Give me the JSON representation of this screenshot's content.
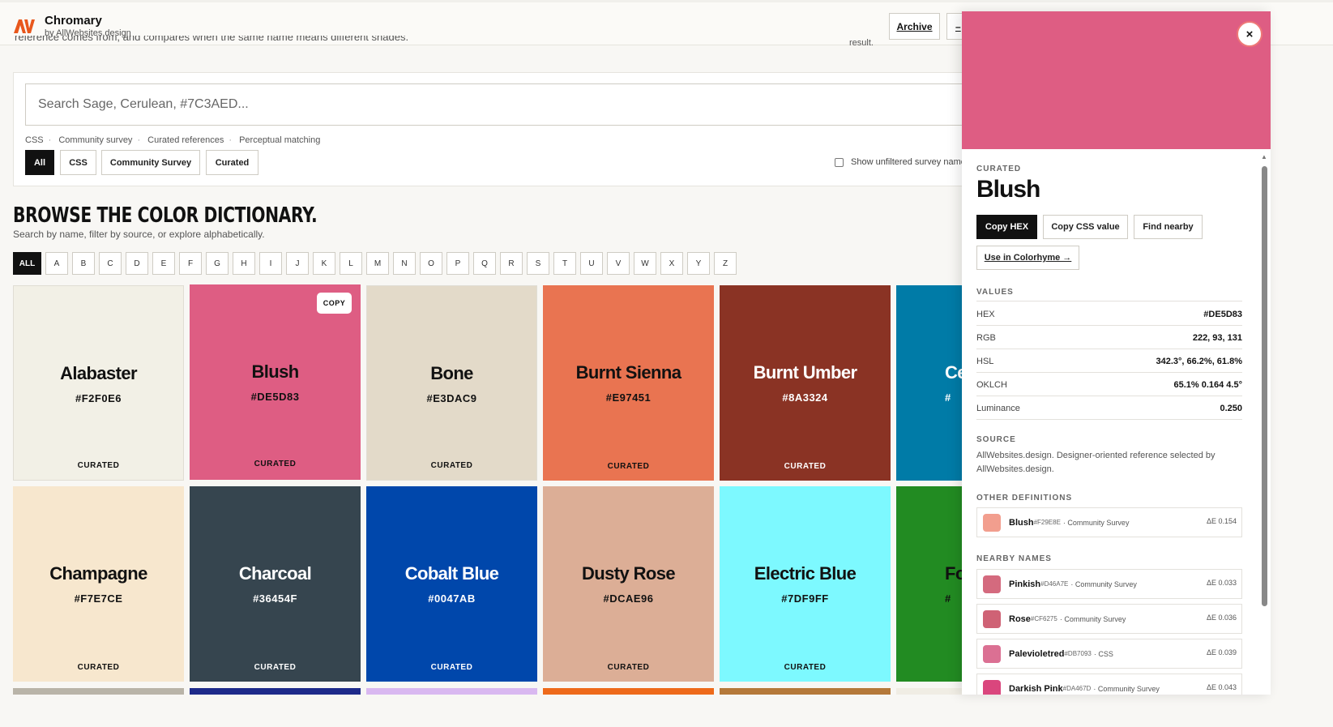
{
  "header": {
    "brand_name": "Chromary",
    "brand_sub": "by AllWebsites.design",
    "archive_label": "Archive",
    "cut_intro": "reference comes from, and compares when the same name means different shades.",
    "cut_right": "result."
  },
  "search": {
    "placeholder": "Search Sage, Cerulean, #7C3AED...",
    "hints": [
      "CSS",
      "Community survey",
      "Curated references",
      "Perceptual matching"
    ],
    "filters": [
      "All",
      "CSS",
      "Community Survey",
      "Curated"
    ],
    "active_filter": "All",
    "unfiltered_label": "Show unfiltered survey names"
  },
  "browse": {
    "title": "BROWSE THE COLOR DICTIONARY.",
    "subtitle": "Search by name, filter by source, or explore alphabetically.",
    "letters": [
      "ALL",
      "A",
      "B",
      "C",
      "D",
      "E",
      "F",
      "G",
      "H",
      "I",
      "J",
      "K",
      "L",
      "M",
      "N",
      "O",
      "P",
      "Q",
      "R",
      "S",
      "T",
      "U",
      "V",
      "W",
      "X",
      "Y",
      "Z"
    ]
  },
  "tiles": [
    {
      "name": "Alabaster",
      "hex": "#F2F0E6",
      "source": "CURATED",
      "bg": "#F2F0E6",
      "fg": "#111111"
    },
    {
      "name": "Blush",
      "hex": "#DE5D83",
      "source": "CURATED",
      "bg": "#DE5D83",
      "fg": "#111111",
      "copy": "COPY"
    },
    {
      "name": "Bone",
      "hex": "#E3DAC9",
      "source": "CURATED",
      "bg": "#E3DAC9",
      "fg": "#111111"
    },
    {
      "name": "Burnt Sienna",
      "hex": "#E97451",
      "source": "CURATED",
      "bg": "#E97451",
      "fg": "#111111"
    },
    {
      "name": "Burnt Umber",
      "hex": "#8A3324",
      "source": "CURATED",
      "bg": "#8A3324",
      "fg": "#FFFFFF"
    },
    {
      "name": "Ce",
      "hex": "#",
      "source": "",
      "bg": "#007BA7",
      "fg": "#FFFFFF"
    },
    {
      "name": "Champagne",
      "hex": "#F7E7CE",
      "source": "CURATED",
      "bg": "#F7E7CE",
      "fg": "#111111"
    },
    {
      "name": "Charcoal",
      "hex": "#36454F",
      "source": "CURATED",
      "bg": "#36454F",
      "fg": "#FFFFFF"
    },
    {
      "name": "Cobalt Blue",
      "hex": "#0047AB",
      "source": "CURATED",
      "bg": "#0047AB",
      "fg": "#FFFFFF"
    },
    {
      "name": "Dusty Rose",
      "hex": "#DCAE96",
      "source": "CURATED",
      "bg": "#DCAE96",
      "fg": "#111111"
    },
    {
      "name": "Electric Blue",
      "hex": "#7DF9FF",
      "source": "CURATED",
      "bg": "#7DF9FF",
      "fg": "#111111"
    },
    {
      "name": "Fore",
      "hex": "#",
      "source": "",
      "bg": "#228B22",
      "fg": "#111111"
    }
  ],
  "strip_colors": [
    "#b9b4a8",
    "#1e2a8a",
    "#d9b8f0",
    "#ee6a1a",
    "#b5793a",
    "#f0ede4"
  ],
  "panel": {
    "swatch_color": "#DE5D83",
    "close": "×",
    "source_badge": "CURATED",
    "name": "Blush",
    "copy_hex": "Copy HEX",
    "copy_css": "Copy CSS value",
    "find_nearby": "Find nearby",
    "use_colorhyme": "Use in Colorhyme →",
    "values_label": "VALUES",
    "values": [
      {
        "k": "HEX",
        "v": "#DE5D83"
      },
      {
        "k": "RGB",
        "v": "222, 93, 131"
      },
      {
        "k": "HSL",
        "v": "342.3°, 66.2%, 61.8%"
      },
      {
        "k": "OKLCH",
        "v": "65.1% 0.164 4.5°"
      },
      {
        "k": "Luminance",
        "v": "0.250"
      }
    ],
    "source_label": "SOURCE",
    "source_text": "AllWebsites.design. Designer-oriented reference selected by AllWebsites.design.",
    "other_label": "OTHER DEFINITIONS",
    "other": [
      {
        "name": "Blush",
        "hex": "#F29E8E",
        "src": "· Community Survey",
        "de": "ΔE 0.154",
        "color": "#F29E8E"
      }
    ],
    "nearby_label": "NEARBY NAMES",
    "nearby": [
      {
        "name": "Pinkish",
        "hex": "#D46A7E",
        "src": "· Community Survey",
        "de": "ΔE 0.033",
        "color": "#D46A7E"
      },
      {
        "name": "Rose",
        "hex": "#CF6275",
        "src": "· Community Survey",
        "de": "ΔE 0.036",
        "color": "#CF6275"
      },
      {
        "name": "Palevioletred",
        "hex": "#DB7093",
        "src": "· CSS",
        "de": "ΔE 0.039",
        "color": "#DB7093"
      },
      {
        "name": "Darkish Pink",
        "hex": "#DA467D",
        "src": "· Community Survey",
        "de": "ΔE 0.043",
        "color": "#DA467D"
      }
    ]
  }
}
